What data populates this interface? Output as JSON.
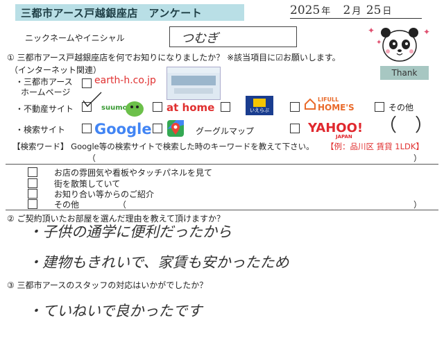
{
  "header": {
    "title": "三都市アース戸越銀座店　アンケート",
    "date": {
      "year": "2025",
      "year_unit": "年",
      "month": "2",
      "month_unit": "月",
      "day": "25",
      "day_unit": "日"
    }
  },
  "nickname": {
    "label": "ニックネームやイニシャル",
    "value": "つむぎ"
  },
  "mascot": {
    "thank_label": "Thank"
  },
  "q1": {
    "text": "① 三都市アース戸越銀座店を何でお知りになりましたか？ ※該当項目に☑お願いします。",
    "internet_label": "（インターネット関連）",
    "homepage_label_1": "・三都市アース",
    "homepage_label_2": "ホームページ",
    "homepage_url": "earth-h.co.jp",
    "realestate_label": "・不動産サイト",
    "suumo": "suumo",
    "athome": "at home",
    "ieshiru": "いえらぶ",
    "lifull": "LIFULL",
    "homes": "HOME'S",
    "other_label": "その他",
    "search_label": "・検索サイト",
    "google": "Google",
    "google_maps": "グーグルマップ",
    "yahoo": "YAHOO!",
    "yahoo_sub": "JAPAN",
    "keyword_label": "【検索ワード】 Google等の検索サイトで検索した時のキーワードを教えて下さい。",
    "keyword_example": "【例：品川区 賃貸 1LDK】",
    "paren_open": "（",
    "paren_close": "）",
    "options": [
      "お店の雰囲気や看板やタッチパネルを見て",
      "街を散策していて",
      "お知り合い等からのご紹介",
      "その他"
    ]
  },
  "q2": {
    "text": "② ご契約頂いたお部屋を選んだ理由を教えて頂けますか？",
    "answer_line1": "・子供の通学に便利だったから",
    "answer_line2": "・建物もきれいで、家賃も安かったため"
  },
  "q3": {
    "text": "③ 三都市アースのスタッフの対応はいかがでしたか？",
    "answer": "・ていねいで良かったです"
  },
  "colors": {
    "title_band": "#b9dfe6",
    "red": "#e03030",
    "thank_tag": "#a7c7c2"
  }
}
